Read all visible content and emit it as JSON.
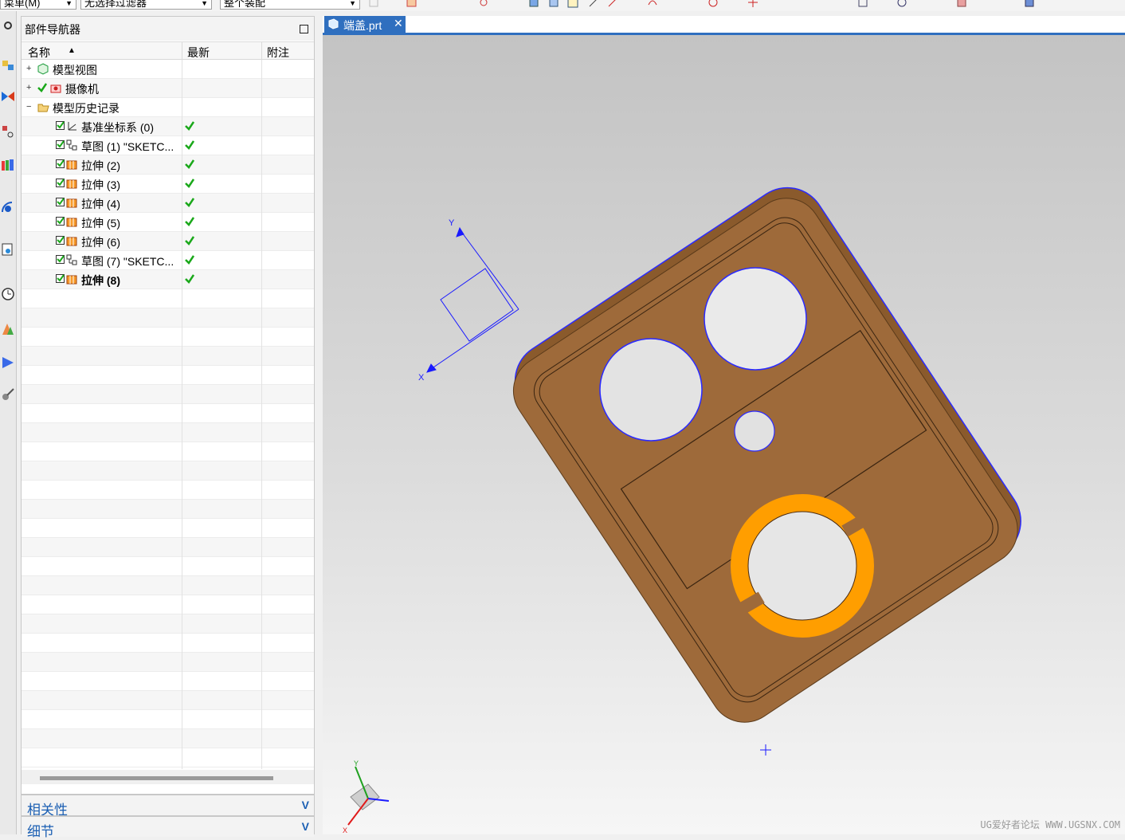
{
  "toolbar": {
    "menu_label": "菜单(M)",
    "selection_filter": "无选择过滤器",
    "assembly_scope": "整个装配"
  },
  "navigator": {
    "title": "部件导航器",
    "columns": {
      "name": "名称",
      "latest": "最新",
      "note": "附注"
    },
    "items": [
      {
        "label": "模型视图",
        "level": 0,
        "expander": "+",
        "icon": "model-views-icon",
        "checked": false,
        "latest": false,
        "bold": false
      },
      {
        "label": "摄像机",
        "level": 0,
        "expander": "+",
        "icon": "camera-icon",
        "checked": true,
        "latest": false,
        "bold": false
      },
      {
        "label": "模型历史记录",
        "level": 0,
        "expander": "−",
        "icon": "folder-open-icon",
        "checked": false,
        "latest": false,
        "bold": false
      },
      {
        "label": "基准坐标系 (0)",
        "level": 1,
        "icon": "datum-csys-icon",
        "checked": true,
        "latest": true,
        "bold": false
      },
      {
        "label": "草图 (1) \"SKETC...",
        "level": 1,
        "icon": "sketch-icon",
        "checked": true,
        "latest": true,
        "bold": false
      },
      {
        "label": "拉伸 (2)",
        "level": 1,
        "icon": "extrude-icon",
        "checked": true,
        "latest": true,
        "bold": false
      },
      {
        "label": "拉伸 (3)",
        "level": 1,
        "icon": "extrude-icon",
        "checked": true,
        "latest": true,
        "bold": false
      },
      {
        "label": "拉伸 (4)",
        "level": 1,
        "icon": "extrude-icon",
        "checked": true,
        "latest": true,
        "bold": false
      },
      {
        "label": "拉伸 (5)",
        "level": 1,
        "icon": "extrude-icon",
        "checked": true,
        "latest": true,
        "bold": false
      },
      {
        "label": "拉伸 (6)",
        "level": 1,
        "icon": "extrude-icon",
        "checked": true,
        "latest": true,
        "bold": false
      },
      {
        "label": "草图 (7) \"SKETC...",
        "level": 1,
        "icon": "sketch-icon",
        "checked": true,
        "latest": true,
        "bold": false
      },
      {
        "label": "拉伸 (8)",
        "level": 1,
        "icon": "extrude-icon",
        "checked": true,
        "latest": true,
        "bold": true
      }
    ],
    "panels": {
      "dependencies": "相关性",
      "details": "细节"
    }
  },
  "graphics": {
    "tab_label": "端盖.prt",
    "tab_close": "✕",
    "csys_labels": {
      "x": "X",
      "y": "Y"
    },
    "watermark": "UG爱好者论坛 WWW.UGSNX.COM",
    "colors": {
      "part_body": "#9e6a3a",
      "highlight": "#ff9e00",
      "csys": "#1a1aff",
      "tab": "#2f6fbf"
    }
  }
}
